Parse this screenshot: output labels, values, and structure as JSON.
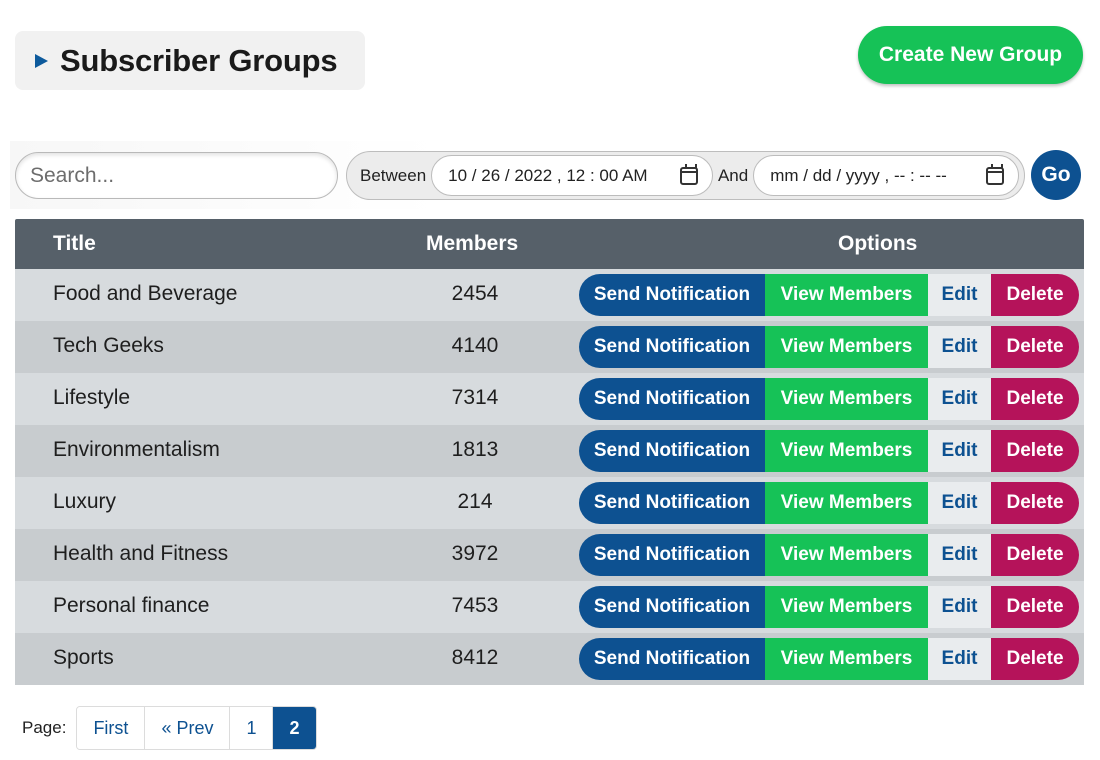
{
  "header": {
    "title": "Subscriber Groups",
    "create_label": "Create New Group"
  },
  "filters": {
    "search_placeholder": "Search...",
    "between_label": "Between",
    "start_value": "10 / 26 / 2022 ,  12 : 00   AM",
    "and_label": "And",
    "end_placeholder": "mm / dd / yyyy ,  -- : --   --",
    "go_label": "Go"
  },
  "table": {
    "columns": {
      "title": "Title",
      "members": "Members",
      "options": "Options"
    },
    "actions": {
      "send": "Send Notification",
      "view": "View Members",
      "edit": "Edit",
      "delete": "Delete"
    },
    "rows": [
      {
        "title": "Food and Beverage",
        "members": "2454"
      },
      {
        "title": "Tech Geeks",
        "members": "4140"
      },
      {
        "title": "Lifestyle",
        "members": "7314"
      },
      {
        "title": "Environmentalism",
        "members": "1813"
      },
      {
        "title": "Luxury",
        "members": "214"
      },
      {
        "title": "Health and Fitness",
        "members": "3972"
      },
      {
        "title": "Personal finance",
        "members": "7453"
      },
      {
        "title": "Sports",
        "members": "8412"
      }
    ]
  },
  "pagination": {
    "label": "Page:",
    "items": [
      {
        "label": "First",
        "active": false
      },
      {
        "label": "« Prev",
        "active": false
      },
      {
        "label": "1",
        "active": false
      },
      {
        "label": "2",
        "active": true
      }
    ]
  },
  "colors": {
    "primary": "#0d5191",
    "success": "#16c257",
    "danger": "#b5135a",
    "header_bg": "#566069"
  }
}
